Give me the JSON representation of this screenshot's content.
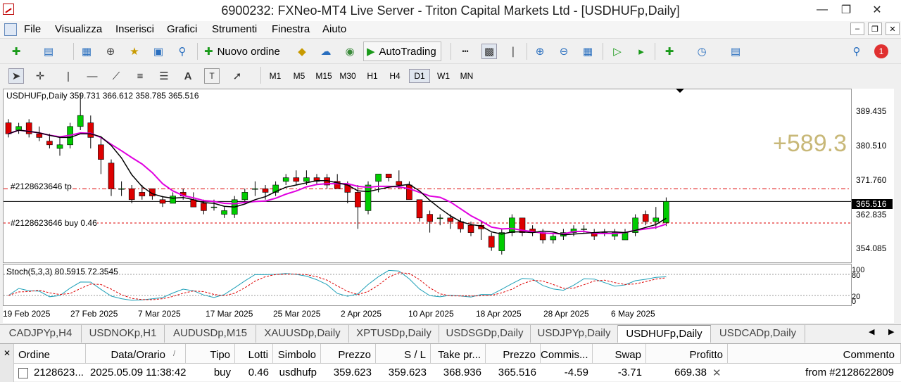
{
  "window": {
    "title": "6900232: FXNeo-MT4 Live Server - Triton Capital Markets Ltd - [USDHUFp,Daily]"
  },
  "menu": [
    "File",
    "Visualizza",
    "Inserisci",
    "Grafici",
    "Strumenti",
    "Finestra",
    "Aiuto"
  ],
  "toolbar": {
    "new_order_label": "Nuovo ordine",
    "autotrading_label": "AutoTrading",
    "notification_count": "1"
  },
  "drawing_tools": {
    "text_tool": "A",
    "label_tool": "T"
  },
  "timeframes": [
    "M1",
    "M5",
    "M15",
    "M30",
    "H1",
    "H4",
    "D1",
    "W1",
    "MN"
  ],
  "active_timeframe": "D1",
  "chart": {
    "header": "USDHUFp,Daily  359.731 366.612 358.785 365.516",
    "profit_overlay": "+589.3",
    "tp_label": "#2128623646 tp",
    "buy_label": "#2128623646 buy 0.46",
    "current_price": "365.516",
    "price_ticks": [
      "389.435",
      "380.510",
      "371.760",
      "362.835",
      "354.085"
    ],
    "date_ticks": [
      "19 Feb 2025",
      "27 Feb 2025",
      "7 Mar 2025",
      "17 Mar 2025",
      "25 Mar 2025",
      "2 Apr 2025",
      "10 Apr 2025",
      "18 Apr 2025",
      "28 Apr 2025",
      "6 May 2025"
    ],
    "stoch_header": "Stoch(5,3,3) 80.5915 72.3545",
    "stoch_ticks": [
      "100",
      "80",
      "20",
      "0"
    ],
    "colors": {
      "bull": "#00cc00",
      "bear": "#dd0000",
      "ma_fast": "#000000",
      "ma_slow": "#e000e0",
      "profit": "#c8b878"
    }
  },
  "chart_data": {
    "type": "candlestick",
    "title": "USDHUFp,Daily",
    "ylim": [
      350,
      395
    ],
    "levels": {
      "tp": 368.936,
      "entry": 359.623,
      "current": 365.516
    },
    "series": [
      {
        "name": "ohlc",
        "values": [
          [
            387,
            388,
            383,
            384
          ],
          [
            385,
            387,
            384,
            386
          ],
          [
            387,
            388,
            383,
            384
          ],
          [
            384,
            386,
            382,
            383
          ],
          [
            382,
            384,
            380,
            381
          ],
          [
            380,
            383,
            378,
            381
          ],
          [
            381,
            387,
            380,
            386
          ],
          [
            386,
            395,
            385,
            389
          ],
          [
            387,
            389,
            380,
            383
          ],
          [
            381,
            383,
            373,
            377
          ],
          [
            376,
            377,
            367,
            369
          ],
          [
            369,
            371,
            367,
            369
          ],
          [
            369,
            370,
            365,
            366
          ],
          [
            368,
            370,
            366,
            367
          ],
          [
            369,
            369,
            366,
            367
          ],
          [
            366,
            367,
            364,
            365
          ],
          [
            365,
            368,
            365,
            367
          ],
          [
            368,
            369,
            366,
            367
          ],
          [
            366,
            368,
            364,
            364
          ],
          [
            365,
            366,
            362,
            363
          ],
          [
            364,
            366,
            363,
            364
          ],
          [
            362,
            364,
            361,
            363
          ],
          [
            362,
            367,
            361,
            366
          ],
          [
            366,
            369,
            365,
            368
          ],
          [
            369,
            371,
            367,
            369
          ],
          [
            369,
            370,
            366,
            368
          ],
          [
            368,
            371,
            367,
            370
          ],
          [
            371,
            373,
            370,
            372
          ],
          [
            372,
            374,
            370,
            371
          ],
          [
            371,
            374,
            370,
            372
          ],
          [
            372,
            373,
            370,
            371
          ],
          [
            372,
            373,
            369,
            370
          ],
          [
            371,
            373,
            369,
            369
          ],
          [
            370,
            371,
            365,
            368
          ],
          [
            368,
            370,
            358,
            364
          ],
          [
            363,
            371,
            362,
            370
          ],
          [
            371,
            373,
            368,
            373
          ],
          [
            373,
            373,
            371,
            372
          ],
          [
            371,
            374,
            369,
            370
          ],
          [
            370,
            371,
            366,
            366
          ],
          [
            366,
            366,
            360,
            361
          ],
          [
            362,
            363,
            357,
            360
          ],
          [
            361,
            362,
            359,
            361
          ],
          [
            361,
            362,
            358,
            360
          ],
          [
            360,
            361,
            357,
            358
          ],
          [
            359,
            360,
            356,
            357
          ],
          [
            359,
            360,
            355,
            358
          ],
          [
            356,
            357,
            352,
            353
          ],
          [
            352,
            358,
            351,
            357
          ],
          [
            357,
            362,
            356,
            361
          ],
          [
            361,
            361,
            356,
            357
          ],
          [
            358,
            359,
            356,
            357
          ],
          [
            357,
            358,
            354,
            355
          ],
          [
            355,
            357,
            354,
            356
          ],
          [
            356,
            358,
            355,
            357
          ],
          [
            357,
            359,
            356,
            358
          ],
          [
            358,
            359,
            357,
            358
          ],
          [
            357,
            358,
            355,
            356
          ],
          [
            357,
            358,
            356,
            357
          ],
          [
            356,
            358,
            355,
            357
          ],
          [
            355,
            358,
            355,
            357
          ],
          [
            357,
            362,
            356,
            361
          ],
          [
            362,
            363,
            359,
            360
          ],
          [
            360,
            364,
            358,
            361
          ],
          [
            359.731,
            366.612,
            358.785,
            365.516
          ]
        ]
      }
    ]
  },
  "tabs": [
    "CADJPYp,H4",
    "USDNOKp,H1",
    "AUDUSDp,M15",
    "XAUUSDp,Daily",
    "XPTUSDp,Daily",
    "USDSGDp,Daily",
    "USDJPYp,Daily",
    "USDHUFp,Daily",
    "USDCADp,Daily"
  ],
  "active_tab": "USDHUFp,Daily",
  "terminal": {
    "headers": [
      "Ordine",
      "Data/Orario",
      "Tipo",
      "Lotti",
      "Simbolo",
      "Prezzo",
      "S / L",
      "Take pr...",
      "Prezzo",
      "Commis...",
      "Swap",
      "Profitto",
      "Commento"
    ],
    "row": [
      "2128623...",
      "2025.05.09 11:38:42",
      "buy",
      "0.46",
      "usdhufp",
      "359.623",
      "359.623",
      "368.936",
      "365.516",
      "-4.59",
      "-3.71",
      "669.38",
      "from #2128622809"
    ]
  }
}
